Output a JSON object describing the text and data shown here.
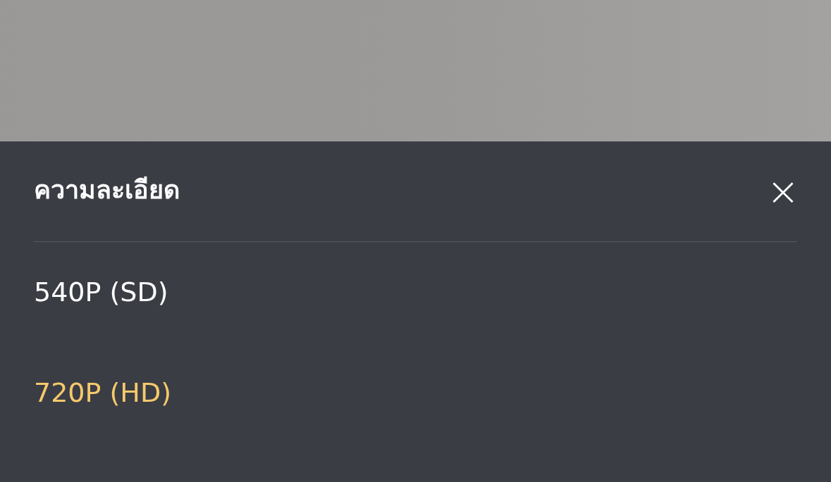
{
  "sheet": {
    "title": "ความละเอียด",
    "close_label": "×"
  },
  "options": [
    {
      "label": "540P (SD)",
      "selected": false
    },
    {
      "label": "720P (HD)",
      "selected": true
    }
  ]
}
